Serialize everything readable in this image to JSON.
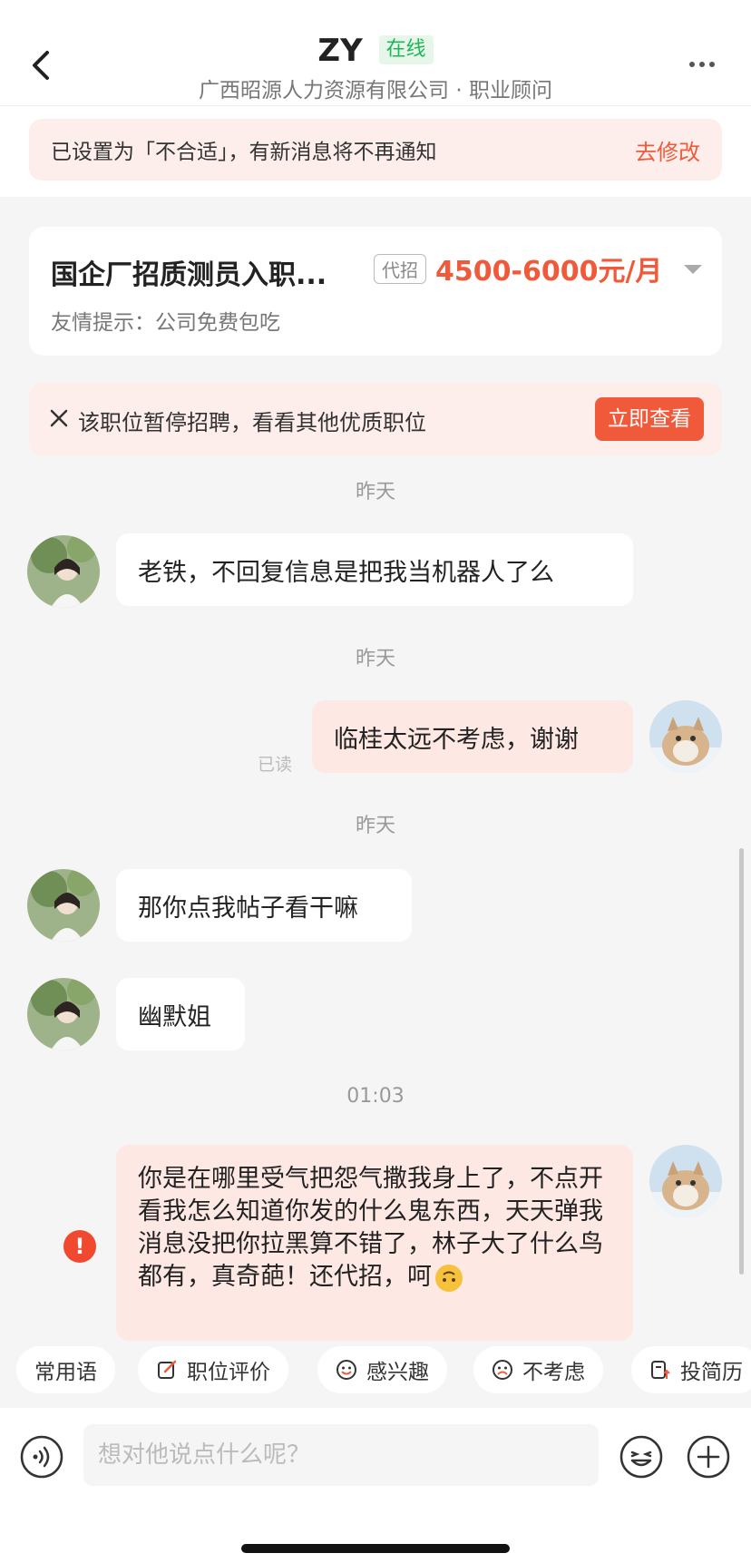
{
  "header": {
    "name": "ZY",
    "status": "在线",
    "subtitle": "广西昭源人力资源有限公司 · 职业顾问"
  },
  "notice": {
    "text": "已设置为「不合适」，有新消息将不再通知",
    "action": "去修改"
  },
  "job": {
    "title": "国企厂招质测员入职...",
    "tag": "代招",
    "salary": "4500-6000元/月",
    "tip": "友情提示：公司免费包吃"
  },
  "paused": {
    "text": "该职位暂停招聘，看看其他优质职位",
    "action": "立即查看"
  },
  "messages": [
    {
      "time": "昨天",
      "from": "other",
      "text": "老铁，不回复信息是把我当机器人了么"
    },
    {
      "time": "昨天",
      "from": "me",
      "text": "临桂太远不考虑，谢谢",
      "status": "已读"
    },
    {
      "time": "昨天",
      "from": "other",
      "text": "那你点我帖子看干嘛"
    },
    {
      "from": "other",
      "text": "幽默姐"
    },
    {
      "time": "01:03",
      "from": "me",
      "failed": "!",
      "text": "你是在哪里受气把怨气撒我身上了，不点开看我怎么知道你发的什么鬼东西，天天弹我消息没把你拉黑算不错了，林子大了什么鸟都有，真奇葩！还代招，呵"
    }
  ],
  "quick_actions": [
    "常用语",
    "职位评价",
    "感兴趣",
    "不考虑",
    "投简历"
  ],
  "input": {
    "placeholder": "想对他说点什么呢？"
  },
  "colors": {
    "accent": "#f05a3a",
    "online": "#21b55a",
    "my_bubble": "#fde8e4",
    "notice_bg": "#fdeeec"
  }
}
